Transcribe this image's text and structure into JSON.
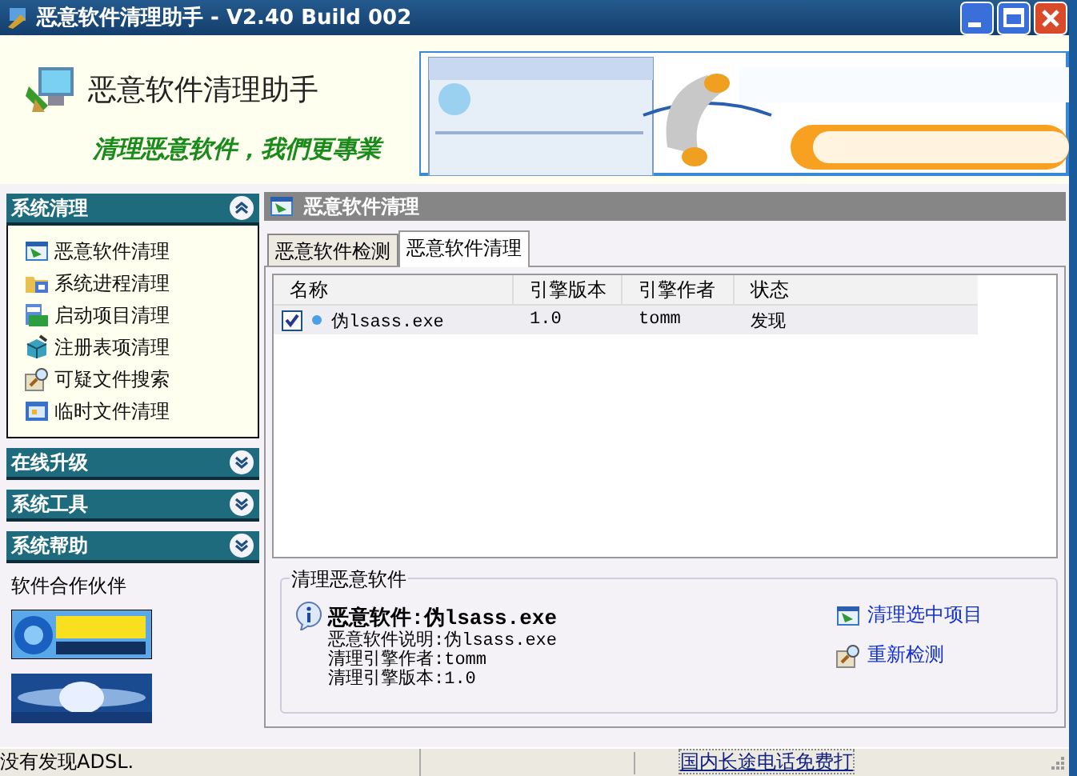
{
  "window": {
    "title": "恶意软件清理助手 - V2.40 Build 002"
  },
  "header": {
    "app_name": "恶意软件清理助手",
    "slogan": "清理恶意软件，我們更專業"
  },
  "sidebar": {
    "sections": [
      {
        "title": "系统清理",
        "expanded": true,
        "items": [
          {
            "label": "恶意软件清理"
          },
          {
            "label": "系统进程清理"
          },
          {
            "label": "启动项目清理"
          },
          {
            "label": "注册表项清理"
          },
          {
            "label": "可疑文件搜索"
          },
          {
            "label": "临时文件清理"
          }
        ]
      },
      {
        "title": "在线升级",
        "expanded": false
      },
      {
        "title": "系统工具",
        "expanded": false
      },
      {
        "title": "系统帮助",
        "expanded": false
      }
    ],
    "partners_label": "软件合作伙伴"
  },
  "main": {
    "panel_title": "恶意软件清理",
    "tabs": [
      {
        "label": "恶意软件检测",
        "selected": false
      },
      {
        "label": "恶意软件清理",
        "selected": true
      }
    ],
    "table": {
      "columns": [
        "名称",
        "引擎版本",
        "引擎作者",
        "状态"
      ],
      "rows": [
        {
          "checked": true,
          "cells": [
            "伪lsass.exe",
            "1.0",
            "tomm",
            "发现"
          ]
        }
      ]
    },
    "details": {
      "group_title": "清理恶意软件",
      "heading": "恶意软件:伪lsass.exe",
      "lines": [
        "恶意软件说明:伪lsass.exe",
        "清理引擎作者:tomm",
        "清理引擎版本:1.0"
      ],
      "actions": [
        {
          "label": "清理选中项目"
        },
        {
          "label": "重新检测"
        }
      ]
    }
  },
  "status_bar": {
    "message": "没有发现ADSL.",
    "link": "国内长途电话免费打"
  }
}
